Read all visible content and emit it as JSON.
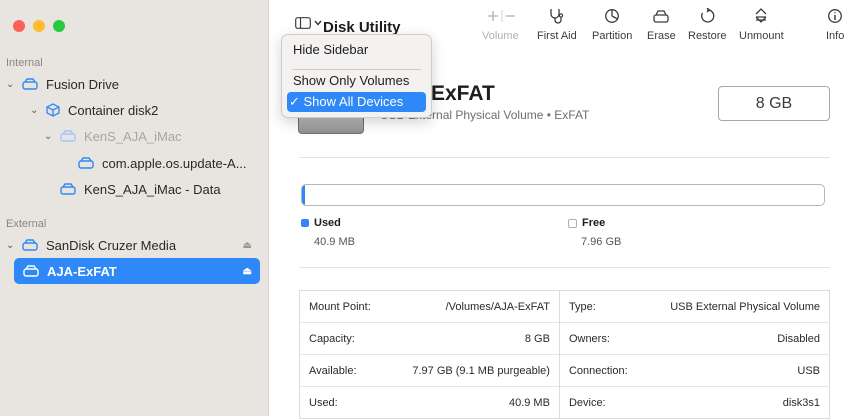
{
  "window": {
    "title": "Disk Utility"
  },
  "sidebar": {
    "sections": {
      "internal": "Internal",
      "external": "External"
    },
    "items": [
      {
        "label": "Fusion Drive"
      },
      {
        "label": "Container disk2"
      },
      {
        "label": "KenS_AJA_iMac"
      },
      {
        "label": "com.apple.os.update-A..."
      },
      {
        "label": "KenS_AJA_iMac - Data"
      },
      {
        "label": "SanDisk Cruzer Media"
      },
      {
        "label": "AJA-ExFAT"
      }
    ]
  },
  "toolbar": {
    "volume": "Volume",
    "first_aid": "First Aid",
    "partition": "Partition",
    "erase": "Erase",
    "restore": "Restore",
    "unmount": "Unmount",
    "info": "Info"
  },
  "view_menu": {
    "hide_sidebar": "Hide Sidebar",
    "show_only_volumes": "Show Only Volumes",
    "show_all_devices": "✓ Show All Devices"
  },
  "volume": {
    "name": "ExFAT",
    "subtitle": "USB External Physical Volume • ExFAT",
    "size": "8 GB",
    "used_fraction": 0.005
  },
  "usage": {
    "used_label": "Used",
    "used_value": "40.9 MB",
    "free_label": "Free",
    "free_value": "7.96 GB"
  },
  "info_table": [
    {
      "k1": "Mount Point:",
      "v1": "/Volumes/AJA-ExFAT",
      "k2": "Type:",
      "v2": "USB External Physical Volume"
    },
    {
      "k1": "Capacity:",
      "v1": "8 GB",
      "k2": "Owners:",
      "v2": "Disabled"
    },
    {
      "k1": "Available:",
      "v1": "7.97 GB (9.1 MB purgeable)",
      "k2": "Connection:",
      "v2": "USB"
    },
    {
      "k1": "Used:",
      "v1": "40.9 MB",
      "k2": "Device:",
      "v2": "disk3s1"
    }
  ],
  "colors": {
    "accent": "#2f88f7",
    "close": "#fe5f57",
    "minimize": "#febc2e",
    "zoom": "#28c840"
  }
}
